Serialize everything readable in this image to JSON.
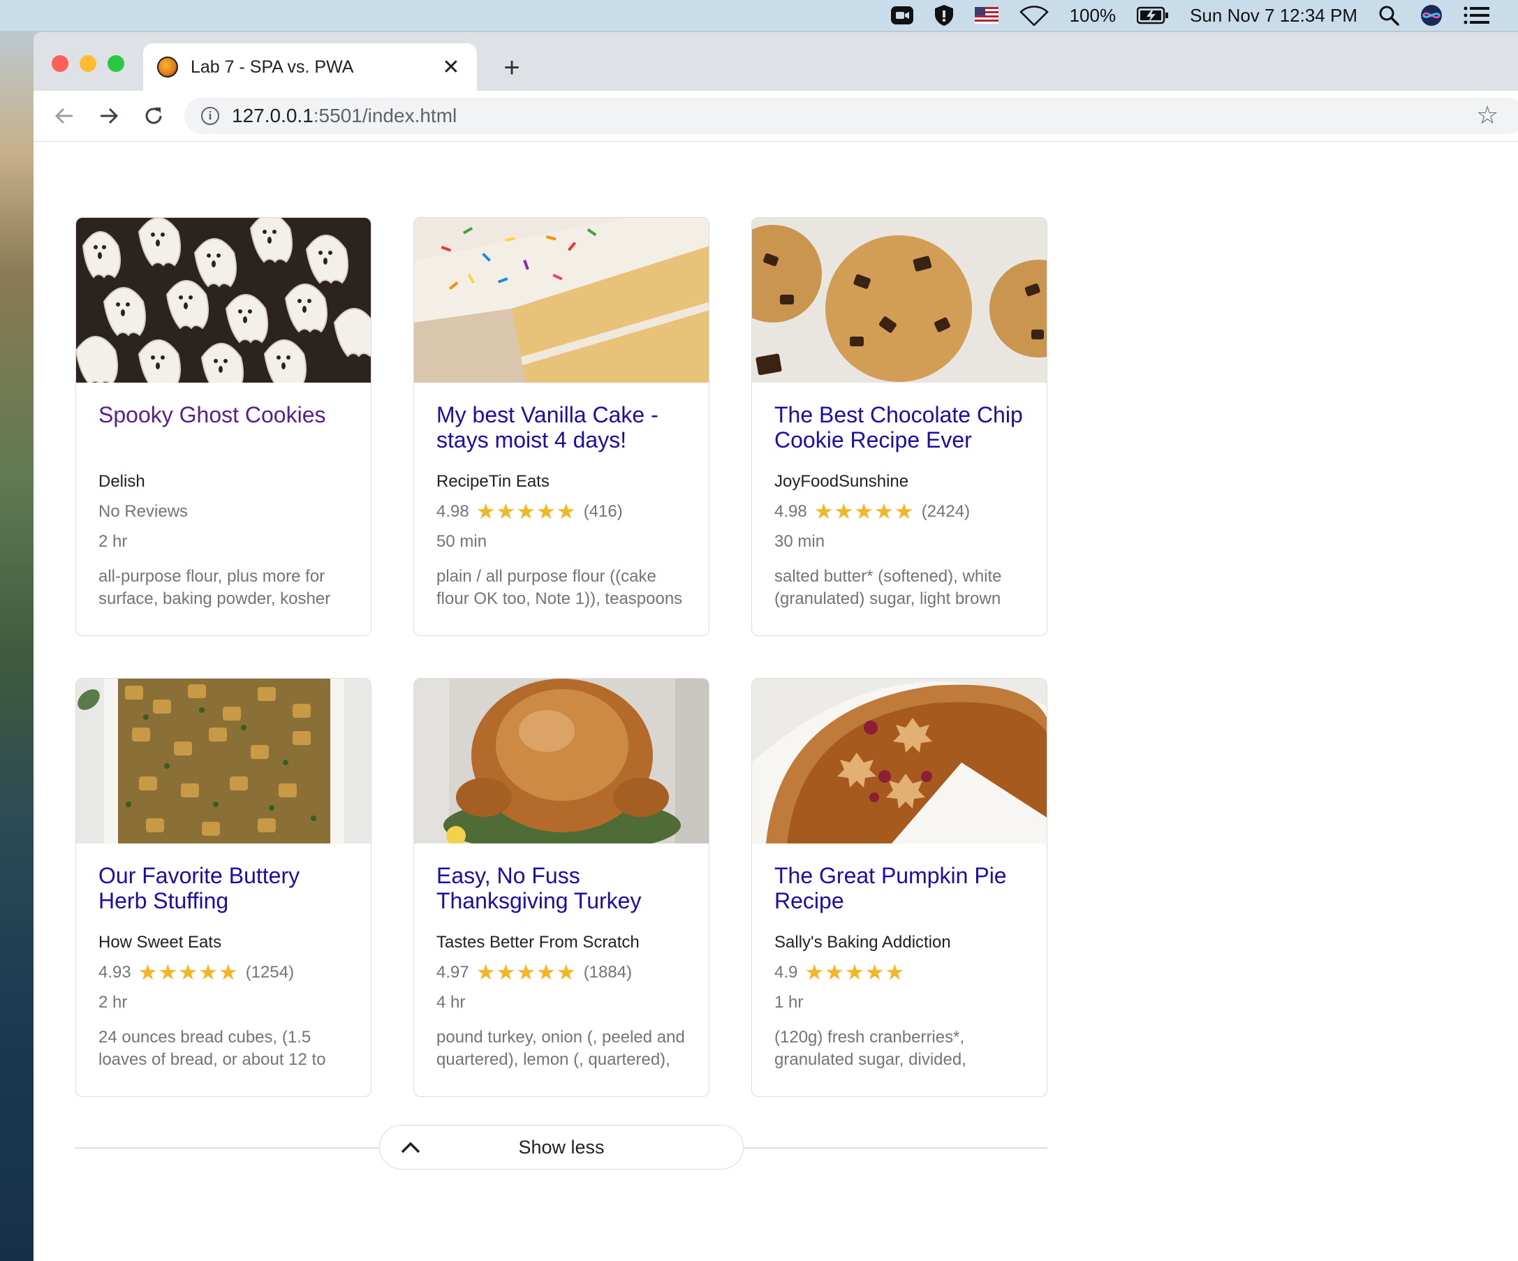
{
  "menubar": {
    "battery": "100%",
    "datetime": "Sun Nov 7  12:34 PM",
    "icons": [
      "zoom-icon",
      "vpn-shield-icon",
      "us-flag-icon",
      "wifi-icon",
      "battery-icon",
      "spotlight-search-icon",
      "siri-icon",
      "control-center-icon"
    ]
  },
  "browser": {
    "tab_title": "Lab 7 - SPA vs. PWA",
    "new_tab_label": "+",
    "url_host": "127.0.0.1",
    "url_path": ":5501/index.html"
  },
  "recipes": [
    {
      "title": "Spooky Ghost Cookies",
      "visited": true,
      "source": "Delish",
      "rating_text": "No Reviews",
      "rating": null,
      "review_count": "",
      "time": "2 hr",
      "ingredients": "all-purpose flour, plus more for surface, baking powder, kosher",
      "image": "ghost cookies"
    },
    {
      "title": "My best Vanilla Cake - stays moist 4 days!",
      "visited": false,
      "source": "RecipeTin Eats",
      "rating": "4.98",
      "stars": "★★★★★",
      "review_count": "(416)",
      "time": "50 min",
      "ingredients": "plain / all purpose flour ((cake flour OK too, Note 1)), teaspoons",
      "image": "vanilla cake"
    },
    {
      "title": "The Best Chocolate Chip Cookie Recipe Ever",
      "visited": false,
      "source": "JoyFoodSunshine",
      "rating": "4.98",
      "stars": "★★★★★",
      "review_count": "(2424)",
      "time": "30 min",
      "ingredients": "salted butter* (softened), white (granulated) sugar, light brown",
      "image": "chocolate chip cookies"
    },
    {
      "title": "Our Favorite Buttery Herb Stuffing",
      "visited": false,
      "source": "How Sweet Eats",
      "rating": "4.93",
      "stars": "★★★★★",
      "review_count": "(1254)",
      "time": "2 hr",
      "ingredients": "24 ounces bread cubes, (1.5 loaves of bread, or about 12 to",
      "image": "herb stuffing"
    },
    {
      "title": "Easy, No Fuss Thanksgiving Turkey",
      "visited": false,
      "source": "Tastes Better From Scratch",
      "rating": "4.97",
      "stars": "★★★★★",
      "review_count": "(1884)",
      "time": "4 hr",
      "ingredients": "pound turkey, onion (, peeled and quartered), lemon (, quartered),",
      "image": "roast turkey"
    },
    {
      "title": "The Great Pumpkin Pie Recipe",
      "visited": false,
      "source": "Sally's Baking Addiction",
      "rating": "4.9",
      "stars": "★★★★★",
      "review_count": "",
      "time": "1 hr",
      "ingredients": "(120g) fresh cranberries*, granulated sugar, divided,",
      "image": "pumpkin pie"
    }
  ],
  "show_less_label": "Show less",
  "colors": {
    "link": "#1a0dab",
    "visited_link": "#5a1d91",
    "star": "#f5b623",
    "muted_text": "#70757a"
  }
}
